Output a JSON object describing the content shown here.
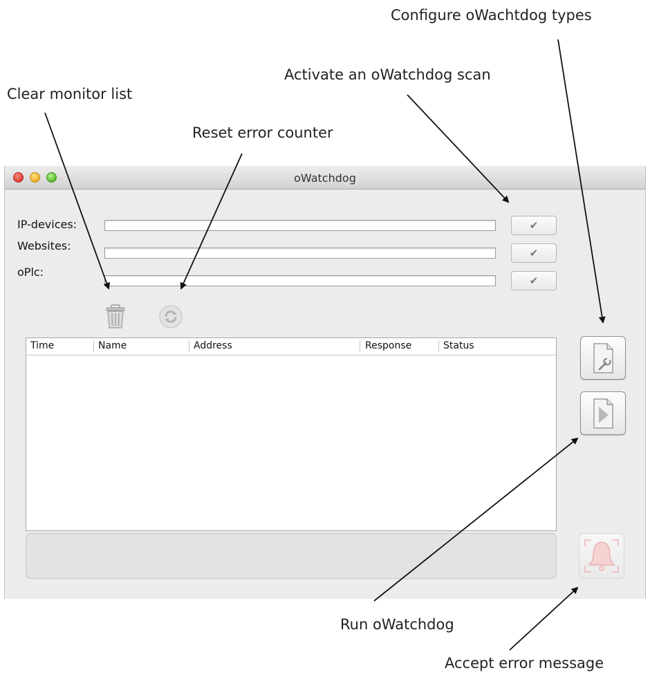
{
  "callouts": {
    "configure": "Configure oWachtdog types",
    "activate": "Activate an oWatchdog scan",
    "clear": "Clear monitor list",
    "reset": "Reset error counter",
    "run": "Run oWatchdog",
    "accept": "Accept error message"
  },
  "window": {
    "title": "oWatchdog"
  },
  "fields": [
    {
      "label": "IP-devices:",
      "value": "",
      "button": "✔"
    },
    {
      "label": "Websites:",
      "value": "",
      "button": "✔"
    },
    {
      "label": "oPlc:",
      "value": "",
      "button": "✔"
    }
  ],
  "icons": {
    "clear": "trash-icon",
    "reset": "refresh-icon",
    "configure": "document-wrench-icon",
    "run": "document-play-icon",
    "accept": "bell-icon"
  },
  "table": {
    "columns": [
      "Time",
      "Name",
      "Address",
      "Response",
      "Status"
    ],
    "rows": []
  },
  "message_area": {
    "text": ""
  },
  "colors": {
    "window_bg": "#ececec",
    "alarm_icon": "#f4c4c4"
  }
}
